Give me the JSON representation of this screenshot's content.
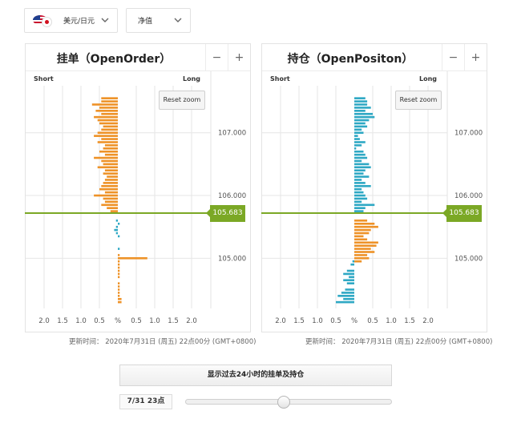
{
  "controls": {
    "pair_label": "美元/日元",
    "mode_label": "净值"
  },
  "colors": {
    "order_bar": "#ee9227",
    "position_bar": "#2ea8c4",
    "price_line": "#7ba825",
    "grid": "#e6e6e6"
  },
  "panels": [
    {
      "title": "挂单（OpenOrder）",
      "short_label": "Short",
      "long_label": "Long",
      "reset_label": "Reset zoom",
      "minus_label": "−",
      "plus_label": "+",
      "x_ticks": [
        "2.0",
        "1.5",
        "1.0",
        "0.5",
        "%",
        "0.5",
        "1.0",
        "1.5",
        "2.0"
      ],
      "y_ticks": [
        "107.000",
        "106.000",
        "105.000"
      ],
      "price_label": "105.683",
      "update_time": "更新时间： 2020年7月31日 (周五) 22点00分   (GMT+0800)"
    },
    {
      "title": "持仓（OpenPositon）",
      "short_label": "Short",
      "long_label": "Long",
      "reset_label": "Reset zoom",
      "minus_label": "−",
      "plus_label": "+",
      "x_ticks": [
        "2.0",
        "1.5",
        "1.0",
        "0.5",
        "%",
        "0.5",
        "1.0",
        "1.5",
        "2.0"
      ],
      "y_ticks": [
        "107.000",
        "106.000",
        "105.000"
      ],
      "price_label": "105.683",
      "update_time": "更新时间： 2020年7月31日 (周五) 22点00分   (GMT+0800)"
    }
  ],
  "show_24h_button": "显示过去24小时的挂单及持仓",
  "slider": {
    "time_label": "7/31 23点",
    "position": 0.48
  },
  "chart_data": [
    {
      "type": "bar",
      "orientation": "horizontal",
      "title": "挂单（OpenOrder）",
      "xlabel": "%",
      "x_range": [
        -2.5,
        2.5
      ],
      "y_range": [
        104.2,
        107.75
      ],
      "y_ticks": [
        107.0,
        106.0,
        105.0
      ],
      "current_price": 105.683,
      "series": [
        {
          "color": "orange",
          "bars": [
            {
              "y": 107.55,
              "x": -0.45
            },
            {
              "y": 107.5,
              "x": -0.45
            },
            {
              "y": 107.45,
              "x": -0.7
            },
            {
              "y": 107.4,
              "x": -0.5
            },
            {
              "y": 107.35,
              "x": -0.6
            },
            {
              "y": 107.3,
              "x": -0.45
            },
            {
              "y": 107.25,
              "x": -0.65
            },
            {
              "y": 107.2,
              "x": -0.55
            },
            {
              "y": 107.15,
              "x": -0.5
            },
            {
              "y": 107.1,
              "x": -0.4
            },
            {
              "y": 107.05,
              "x": -0.45
            },
            {
              "y": 107.0,
              "x": -0.55
            },
            {
              "y": 106.95,
              "x": -0.65
            },
            {
              "y": 106.9,
              "x": -0.45
            },
            {
              "y": 106.85,
              "x": -0.55
            },
            {
              "y": 106.8,
              "x": -0.35
            },
            {
              "y": 106.75,
              "x": -0.4
            },
            {
              "y": 106.7,
              "x": -0.5
            },
            {
              "y": 106.65,
              "x": -0.35
            },
            {
              "y": 106.6,
              "x": -0.65
            },
            {
              "y": 106.55,
              "x": -0.45
            },
            {
              "y": 106.5,
              "x": -0.4
            },
            {
              "y": 106.45,
              "x": -0.55
            },
            {
              "y": 106.4,
              "x": -0.35
            },
            {
              "y": 106.35,
              "x": -0.4
            },
            {
              "y": 106.3,
              "x": -0.3
            },
            {
              "y": 106.25,
              "x": -0.35
            },
            {
              "y": 106.2,
              "x": -0.4
            },
            {
              "y": 106.15,
              "x": -0.45
            },
            {
              "y": 106.1,
              "x": -0.5
            },
            {
              "y": 106.05,
              "x": -0.35
            },
            {
              "y": 106.0,
              "x": -0.65
            },
            {
              "y": 105.95,
              "x": -0.4
            },
            {
              "y": 105.9,
              "x": -0.35
            },
            {
              "y": 105.85,
              "x": -0.45
            },
            {
              "y": 105.8,
              "x": -0.3
            },
            {
              "y": 105.75,
              "x": -0.2
            },
            {
              "y": 105.05,
              "x": 0.05
            },
            {
              "y": 105.0,
              "x": 0.8
            },
            {
              "y": 104.95,
              "x": 0.05
            },
            {
              "y": 104.9,
              "x": 0.05
            },
            {
              "y": 104.85,
              "x": 0.05
            },
            {
              "y": 104.8,
              "x": 0.05
            },
            {
              "y": 104.75,
              "x": 0.05
            },
            {
              "y": 104.7,
              "x": 0.05
            },
            {
              "y": 104.6,
              "x": 0.05
            },
            {
              "y": 104.55,
              "x": 0.05
            },
            {
              "y": 104.5,
              "x": 0.05
            },
            {
              "y": 104.45,
              "x": 0.05
            },
            {
              "y": 104.4,
              "x": 0.05
            },
            {
              "y": 104.35,
              "x": 0.1
            },
            {
              "y": 104.3,
              "x": 0.1
            }
          ]
        },
        {
          "color": "blue",
          "bars": [
            {
              "y": 105.6,
              "x": -0.05
            },
            {
              "y": 105.55,
              "x": 0.05
            },
            {
              "y": 105.5,
              "x": -0.05
            },
            {
              "y": 105.45,
              "x": -0.1
            },
            {
              "y": 105.4,
              "x": -0.05
            },
            {
              "y": 105.35,
              "x": 0.05
            },
            {
              "y": 105.15,
              "x": 0.05
            }
          ]
        }
      ]
    },
    {
      "type": "bar",
      "orientation": "horizontal",
      "title": "持仓（OpenPositon）",
      "xlabel": "%",
      "x_range": [
        -2.5,
        2.5
      ],
      "y_range": [
        104.2,
        107.75
      ],
      "y_ticks": [
        107.0,
        106.0,
        105.0
      ],
      "current_price": 105.683,
      "series": [
        {
          "color": "blue",
          "bars": [
            {
              "y": 107.55,
              "x": 0.3
            },
            {
              "y": 107.5,
              "x": 0.35
            },
            {
              "y": 107.45,
              "x": 0.35
            },
            {
              "y": 107.4,
              "x": 0.45
            },
            {
              "y": 107.35,
              "x": 0.3
            },
            {
              "y": 107.3,
              "x": 0.5
            },
            {
              "y": 107.25,
              "x": 0.55
            },
            {
              "y": 107.2,
              "x": 0.4
            },
            {
              "y": 107.15,
              "x": 0.3
            },
            {
              "y": 107.1,
              "x": 0.35
            },
            {
              "y": 107.05,
              "x": 0.2
            },
            {
              "y": 107.0,
              "x": 0.25
            },
            {
              "y": 106.95,
              "x": 0.1
            },
            {
              "y": 106.9,
              "x": 0.15
            },
            {
              "y": 106.85,
              "x": 0.3
            },
            {
              "y": 106.8,
              "x": 0.2
            },
            {
              "y": 106.75,
              "x": 0.05
            },
            {
              "y": 106.7,
              "x": 0.25
            },
            {
              "y": 106.65,
              "x": 0.3
            },
            {
              "y": 106.6,
              "x": 0.35
            },
            {
              "y": 106.55,
              "x": 0.2
            },
            {
              "y": 106.5,
              "x": 0.4
            },
            {
              "y": 106.45,
              "x": 0.45
            },
            {
              "y": 106.4,
              "x": 0.3
            },
            {
              "y": 106.35,
              "x": 0.25
            },
            {
              "y": 106.3,
              "x": 0.4
            },
            {
              "y": 106.25,
              "x": 0.2
            },
            {
              "y": 106.2,
              "x": 0.3
            },
            {
              "y": 106.15,
              "x": 0.45
            },
            {
              "y": 106.1,
              "x": 0.2
            },
            {
              "y": 106.05,
              "x": 0.25
            },
            {
              "y": 106.0,
              "x": 0.3
            },
            {
              "y": 105.95,
              "x": 0.35
            },
            {
              "y": 105.9,
              "x": 0.2
            },
            {
              "y": 105.85,
              "x": 0.55
            },
            {
              "y": 105.8,
              "x": 0.3
            },
            {
              "y": 105.75,
              "x": 0.25
            },
            {
              "y": 104.95,
              "x": -0.05
            },
            {
              "y": 104.9,
              "x": -0.1
            },
            {
              "y": 104.8,
              "x": -0.2
            },
            {
              "y": 104.75,
              "x": -0.3
            },
            {
              "y": 104.7,
              "x": -0.15
            },
            {
              "y": 104.65,
              "x": -0.3
            },
            {
              "y": 104.6,
              "x": -0.2
            },
            {
              "y": 104.5,
              "x": -0.25
            },
            {
              "y": 104.45,
              "x": -0.35
            },
            {
              "y": 104.4,
              "x": -0.45
            },
            {
              "y": 104.35,
              "x": -0.3
            },
            {
              "y": 104.3,
              "x": -0.5
            }
          ]
        },
        {
          "color": "orange",
          "bars": [
            {
              "y": 105.6,
              "x": 0.35
            },
            {
              "y": 105.55,
              "x": 0.55
            },
            {
              "y": 105.5,
              "x": 0.65
            },
            {
              "y": 105.45,
              "x": 0.45
            },
            {
              "y": 105.4,
              "x": 0.4
            },
            {
              "y": 105.35,
              "x": 0.25
            },
            {
              "y": 105.3,
              "x": 0.35
            },
            {
              "y": 105.25,
              "x": 0.65
            },
            {
              "y": 105.2,
              "x": 0.6
            },
            {
              "y": 105.15,
              "x": 0.45
            },
            {
              "y": 105.1,
              "x": 0.55
            },
            {
              "y": 105.05,
              "x": 0.35
            },
            {
              "y": 105.0,
              "x": 0.4
            },
            {
              "y": 104.95,
              "x": 0.2
            }
          ]
        }
      ]
    }
  ]
}
